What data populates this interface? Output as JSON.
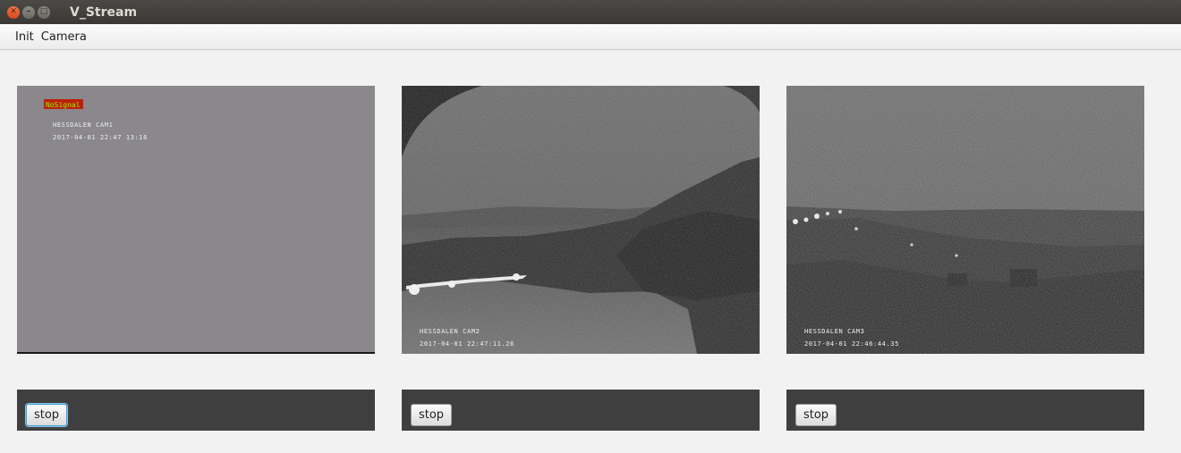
{
  "window": {
    "title": "V_Stream",
    "controls": [
      "close-icon",
      "minimize-icon",
      "maximize-icon"
    ]
  },
  "menu": [
    "Init",
    "Camera"
  ],
  "cameras": [
    {
      "status": "NoSignal",
      "overlay_name": "HESSDALEN CAM1",
      "overlay_time": "2017-04-01 22:47 13:16",
      "button_label": "stop",
      "focused": true
    },
    {
      "overlay_name": "HESSDALEN CAM2",
      "overlay_time": "2017-04-01 22:47:11.26",
      "button_label": "stop"
    },
    {
      "overlay_name": "HESSDALEN CAM3",
      "overlay_time": "2017-04-01 22:46:44.35",
      "button_label": "stop"
    }
  ],
  "colors": {
    "nosignal_bg": "#8a888b",
    "nosignal_badge": "#ff2a00",
    "nosignal_text": "#7fff00",
    "control_bar": "#3f3f3f"
  }
}
